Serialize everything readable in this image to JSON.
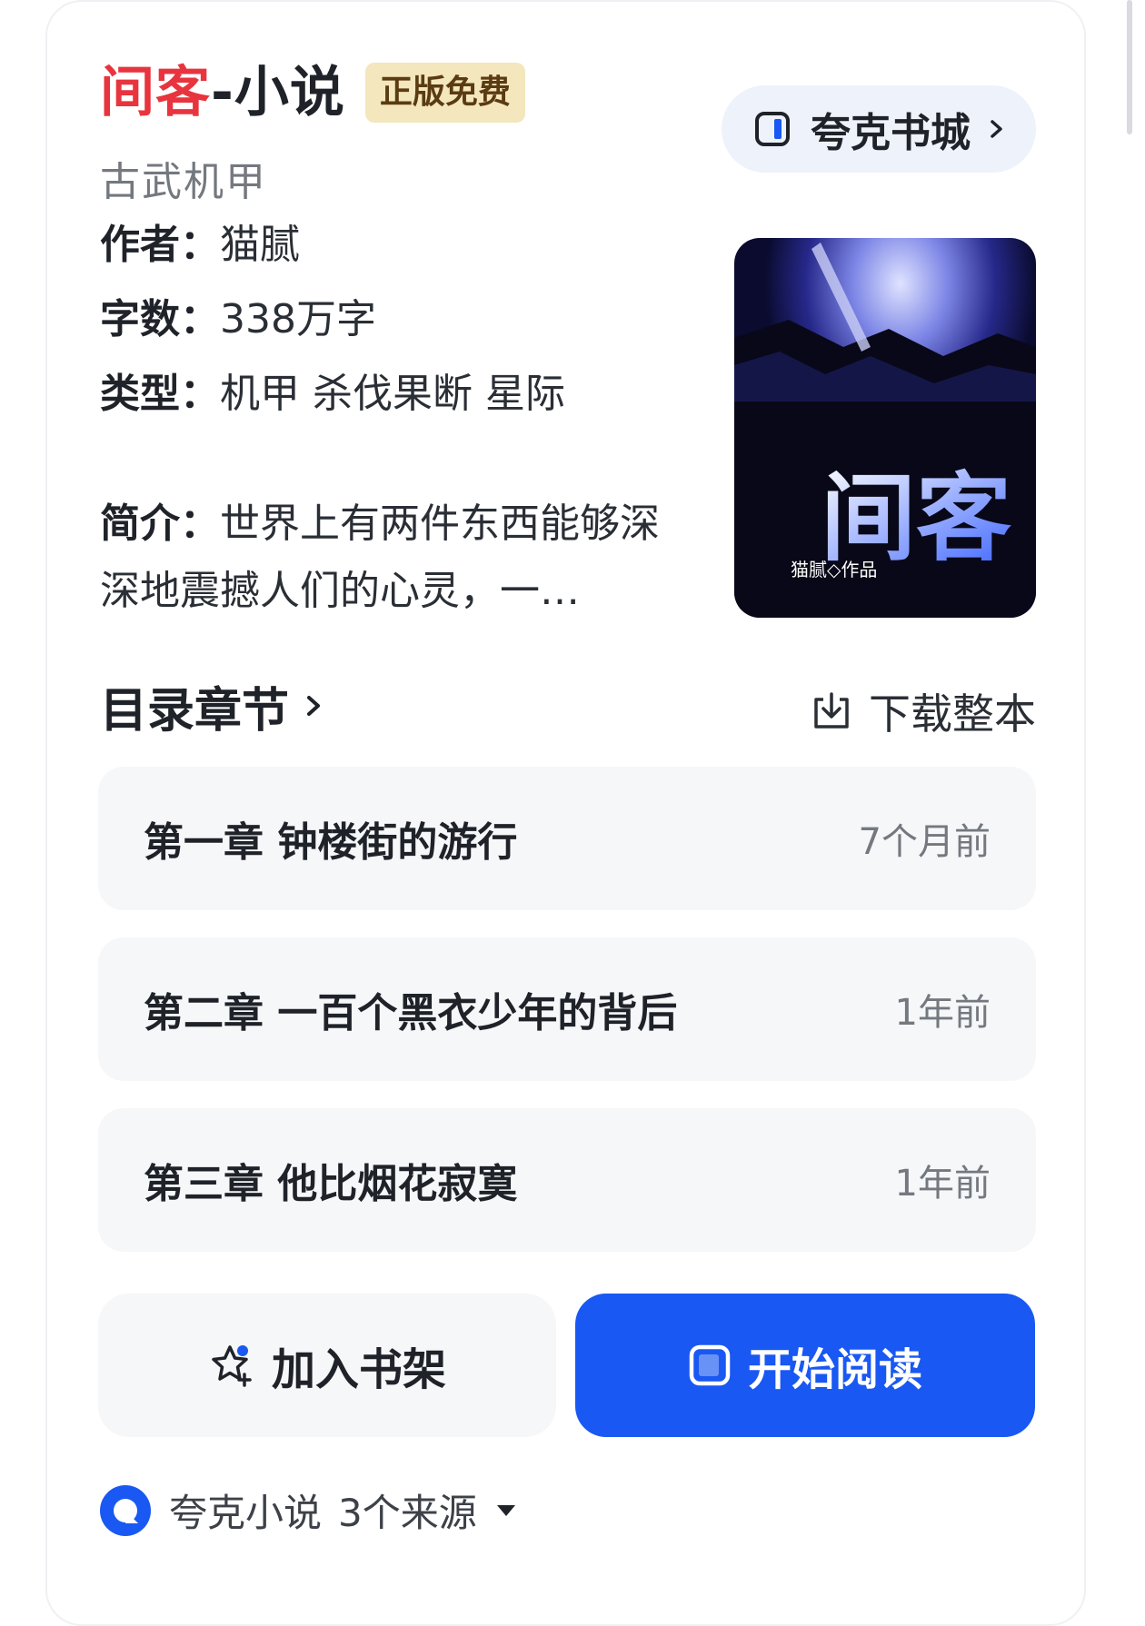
{
  "book": {
    "title_red": "间客",
    "title_rest": "-小说",
    "badge": "正版免费",
    "subtitle": "古武机甲",
    "author_label": "作者：",
    "author": "猫腻",
    "words_label": "字数：",
    "words": "338万字",
    "genre_label": "类型：",
    "genre": "机甲 杀伐果断 星际",
    "intro_label": "简介：",
    "intro": "世界上有两件东西能够深深地震撼人们的心灵，一…",
    "cover": {
      "title": "间客",
      "author_mark": "猫腻◇作品"
    }
  },
  "store_button": {
    "label": "夸克书城",
    "icon": "book-icon"
  },
  "toc": {
    "title": "目录章节",
    "download_label": "下载整本",
    "chapters": [
      {
        "name": "第一章 钟楼街的游行",
        "time": "7个月前"
      },
      {
        "name": "第二章 一百个黑衣少年的背后",
        "time": "1年前"
      },
      {
        "name": "第三章 他比烟花寂寞",
        "time": "1年前"
      }
    ]
  },
  "actions": {
    "add_shelf": "加入书架",
    "start_read": "开始阅读"
  },
  "source": {
    "app": "夸克小说",
    "count": "3个来源"
  },
  "colors": {
    "accent": "#1958f2",
    "title_red": "#e8343e",
    "badge_bg": "#f4e6bd"
  }
}
